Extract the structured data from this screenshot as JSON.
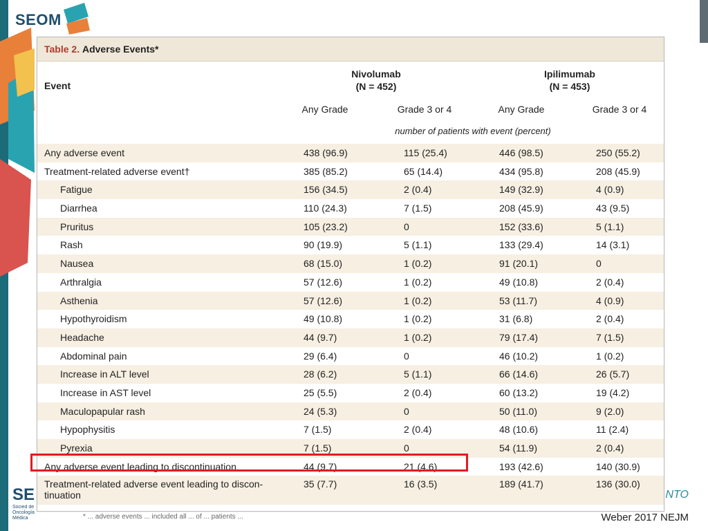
{
  "slide": {
    "logo_text": "SEOM",
    "bottom_logo_text": "SE",
    "bottom_logo_small": "Socied de Oncología Médica",
    "right_fragment": "NTO",
    "citation": "Weber 2017 NEJM",
    "footnote_fragment": "* ... adverse events ... included all ... of ... patients ..."
  },
  "table": {
    "label": "Table 2.",
    "title": "Adverse Events*",
    "event_header": "Event",
    "group1": {
      "name": "Nivolumab",
      "n": "(N = 452)"
    },
    "group2": {
      "name": "Ipilimumab",
      "n": "(N = 453)"
    },
    "subheaders": [
      "Any Grade",
      "Grade 3 or 4",
      "Any Grade",
      "Grade 3 or 4"
    ],
    "unit_note": "number of patients with event (percent)",
    "rows": [
      {
        "event": "Any adverse event",
        "values": [
          "438 (96.9)",
          "115 (25.4)",
          "446 (98.5)",
          "250 (55.2)"
        ]
      },
      {
        "event": "Treatment-related adverse event†",
        "values": [
          "385 (85.2)",
          "65 (14.4)",
          "434 (95.8)",
          "208 (45.9)"
        ]
      },
      {
        "event": "Fatigue",
        "values": [
          "156 (34.5)",
          "2 (0.4)",
          "149 (32.9)",
          "4 (0.9)"
        ]
      },
      {
        "event": "Diarrhea",
        "values": [
          "110 (24.3)",
          "7 (1.5)",
          "208 (45.9)",
          "43 (9.5)"
        ]
      },
      {
        "event": "Pruritus",
        "values": [
          "105 (23.2)",
          "0",
          "152 (33.6)",
          "5 (1.1)"
        ]
      },
      {
        "event": "Rash",
        "values": [
          "90 (19.9)",
          "5 (1.1)",
          "133 (29.4)",
          "14 (3.1)"
        ]
      },
      {
        "event": "Nausea",
        "values": [
          "68 (15.0)",
          "1 (0.2)",
          "91 (20.1)",
          "0"
        ]
      },
      {
        "event": "Arthralgia",
        "values": [
          "57 (12.6)",
          "1 (0.2)",
          "49 (10.8)",
          "2 (0.4)"
        ]
      },
      {
        "event": "Asthenia",
        "values": [
          "57 (12.6)",
          "1 (0.2)",
          "53 (11.7)",
          "4 (0.9)"
        ]
      },
      {
        "event": "Hypothyroidism",
        "values": [
          "49 (10.8)",
          "1 (0.2)",
          "31 (6.8)",
          "2 (0.4)"
        ]
      },
      {
        "event": "Headache",
        "values": [
          "44 (9.7)",
          "1 (0.2)",
          "79 (17.4)",
          "7 (1.5)"
        ]
      },
      {
        "event": "Abdominal pain",
        "values": [
          "29 (6.4)",
          "0",
          "46 (10.2)",
          "1 (0.2)"
        ]
      },
      {
        "event": "Increase in ALT level",
        "values": [
          "28 (6.2)",
          "5 (1.1)",
          "66 (14.6)",
          "26 (5.7)"
        ]
      },
      {
        "event": "Increase in AST level",
        "values": [
          "25 (5.5)",
          "2 (0.4)",
          "60 (13.2)",
          "19 (4.2)"
        ]
      },
      {
        "event": "Maculopapular rash",
        "values": [
          "24 (5.3)",
          "0",
          "50 (11.0)",
          "9 (2.0)"
        ]
      },
      {
        "event": "Hypophysitis",
        "values": [
          "7 (1.5)",
          "2 (0.4)",
          "48 (10.6)",
          "11 (2.4)"
        ]
      },
      {
        "event": "Pyrexia",
        "values": [
          "7 (1.5)",
          "0",
          "54 (11.9)",
          "2 (0.4)"
        ]
      },
      {
        "event": "Any adverse event leading to discontinuation",
        "values": [
          "44 (9.7)",
          "21 (4.6)",
          "193 (42.6)",
          "140 (30.9)"
        ]
      },
      {
        "event": "Treatment-related adverse event leading to discon-\ntinuation",
        "values": [
          "35 (7.7)",
          "16 (3.5)",
          "189 (41.7)",
          "136 (30.0)"
        ]
      }
    ]
  },
  "colors": {
    "highlight": "#e01b24",
    "title_label": "#b03a2e",
    "row_shade": "#f6efe2"
  }
}
